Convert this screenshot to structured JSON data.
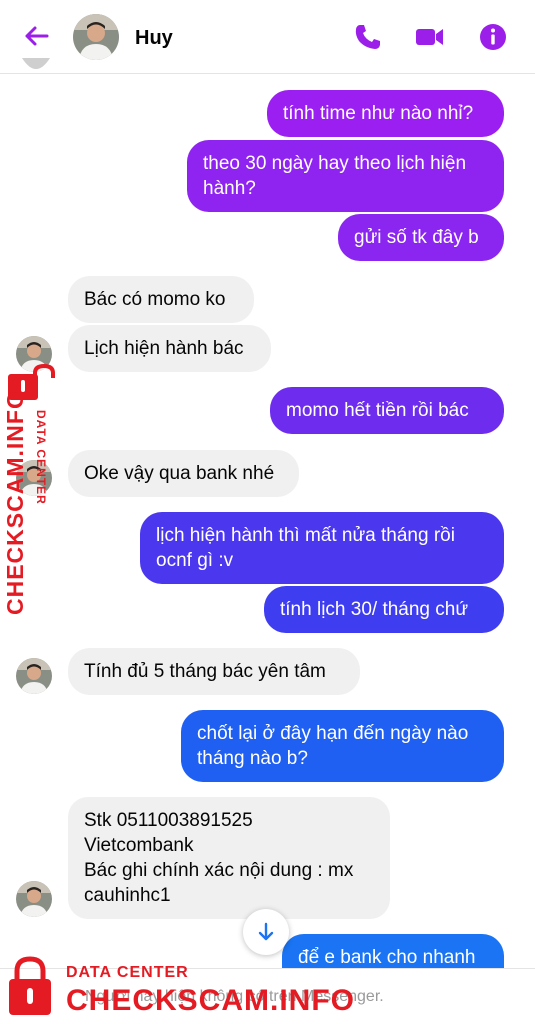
{
  "header": {
    "contact_name": "Huy"
  },
  "icons": {
    "back": "arrow-left-icon",
    "call": "phone-icon",
    "video": "video-camera-icon",
    "info": "info-icon",
    "scroll_down": "arrow-down-icon",
    "watermark_lock": "lock-icon"
  },
  "colors": {
    "accent": "#9b1fe8",
    "incoming_bubble": "#f0f0f0",
    "watermark": "#e41b23"
  },
  "messages": [
    {
      "sender": "me",
      "text": "tính time như nào nhỉ?"
    },
    {
      "sender": "me",
      "text": "theo 30 ngày hay theo lịch hiện hành?"
    },
    {
      "sender": "me",
      "text": "gửi số tk đây b"
    },
    {
      "sender": "Huy",
      "text": "Bác có momo ko"
    },
    {
      "sender": "Huy",
      "text": "Lịch hiện hành bác"
    },
    {
      "sender": "me",
      "text": "momo hết tiền rồi bác"
    },
    {
      "sender": "Huy",
      "text": "Oke vậy qua bank nhé"
    },
    {
      "sender": "me",
      "text": "lịch hiện hành thì mất nửa tháng rồi ocnf gì :v"
    },
    {
      "sender": "me",
      "text": "tính lịch 30/ tháng chứ"
    },
    {
      "sender": "Huy",
      "text": "Tính đủ 5 tháng bác yên tâm"
    },
    {
      "sender": "me",
      "text": "chốt lại ở đây hạn đến ngày nào tháng nào b?"
    },
    {
      "sender": "Huy",
      "text": "Stk 0511003891525\nVietcombank\nBác ghi chính xác nội dung : mx cauhinhc1"
    },
    {
      "sender": "me",
      "text": "để e bank cho nhanh"
    }
  ],
  "footer": {
    "notice": "Người này hiện không có trên Messenger."
  },
  "watermark": {
    "small": "DATA CENTER",
    "big": "CHECKSCAM.INFO"
  }
}
